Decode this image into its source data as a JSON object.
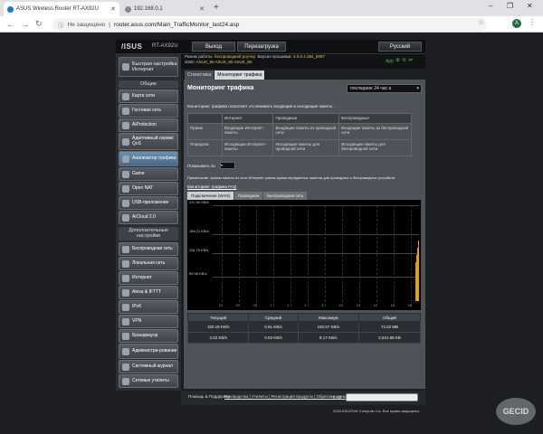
{
  "browser": {
    "tabs": [
      {
        "title": "ASUS Wireless Router RT-AX92U"
      },
      {
        "title": "192.168.0.1"
      }
    ],
    "new_tab": "+",
    "window": {
      "min": "–",
      "max": "❐",
      "close": "✕"
    },
    "address": {
      "security": "Не защищено",
      "url": "router.asus.com/Main_TrafficMonitor_last24.asp"
    },
    "avatar": "A"
  },
  "router": {
    "brand": "/ISUS",
    "model": "RT-AX92U",
    "header_buttons": {
      "logout": "Выход",
      "reboot": "Перезагрузка",
      "language": "Русский"
    },
    "status": {
      "mode_label": "Режим работы:",
      "mode_value": "беспроводной роутер",
      "firmware_label": "Версия прошивки:",
      "firmware_value": "3.0.0.4.384_8097",
      "ssid_label": "SSID:",
      "ssid_values": "ASUS_90  ASUS_90  ASUS_90",
      "app": "App"
    },
    "quick_setup": "Быстрая настройка Интернет",
    "sections": {
      "general": "Общие",
      "advanced": "Дополнительные настройки"
    },
    "nav_general": [
      "Карта сети",
      "Гостевая сеть",
      "AiProtection",
      "Адаптивный сервис QoS",
      "Анализатор трафика",
      "Game",
      "Open NAT",
      "USB-приложение",
      "AiCloud 2.0"
    ],
    "nav_advanced": [
      "Беспроводная сеть",
      "Локальная сеть",
      "Интернет",
      "Alexa & IFTTT",
      "IPv6",
      "VPN",
      "Брандмауэр",
      "Администри-рование",
      "Системный журнал",
      "Сетевые утилиты"
    ],
    "content_tabs": [
      "Статистика",
      "Мониторинг трафика"
    ],
    "page_title": "Мониторинг трафика",
    "period_select": "последние  24  час а",
    "description": "Мониторинг трафика позволяет отслеживать входящие и исходящие пакеты :",
    "legend": {
      "headers": [
        "Интернет",
        "Проводные",
        "Беспроводные"
      ],
      "rows": [
        {
          "label": "Прием",
          "internet": "Входящие Интернет-пакеты",
          "wired": "Входящие пакеты из проводной сети",
          "wireless": "Входящие пакеты из беспроводной сети"
        },
        {
          "label": "Передача",
          "internet": "Исходящие Интернет-пакеты",
          "wired": "Исходящие пакеты для проводной сети",
          "wireless": "Исходящие пакеты для беспроводной сети"
        }
      ]
    },
    "show_by_label": "Показывать по",
    "note": "Примечание: приказ пакеты из сети Интернет равна сумма переданных пакетов для проводных и беспроводных устройств.",
    "faq_link": "Мониторинг трафика FAQ",
    "graph_tabs": [
      "Подключение (WAN)",
      "Проводная",
      "Беспроводная сеть"
    ],
    "chart_data": {
      "type": "line",
      "title": "",
      "xlabel": "",
      "ylabel": "",
      "y_ticks": [
        "237.50 KB/s",
        "166.21 KB/s",
        "118.75 KB/s",
        "59.38 KB/s"
      ],
      "y_values": [
        237.5,
        166.21,
        118.75,
        59.38
      ],
      "x_ticks": [
        "20",
        "22",
        "24",
        "2",
        "4",
        "6",
        "8",
        "10",
        "12",
        "14",
        "16",
        "18"
      ],
      "ylim": [
        0,
        237.5
      ],
      "grid": true,
      "series": [
        {
          "values": [
            0,
            0,
            0,
            0,
            0,
            0,
            0,
            0,
            0,
            0,
            0,
            150.57
          ]
        }
      ]
    },
    "stats": {
      "headers": [
        "Текущий",
        "Средний",
        "Максимум",
        "Общий"
      ],
      "rx": [
        "150.18 KB/s",
        "0.61 KB/s",
        "150.57 KB/s",
        "74.02 MB"
      ],
      "tx": [
        "2.52 KB/s",
        "0.03 KB/s",
        "8.17 KB/s",
        "2,541.88 KB"
      ]
    },
    "footer": {
      "help": "Помощь & Поддержка",
      "links": "Руководство | Утилиты | Регистрация продукта | Обратная связь",
      "faq": "FAQ",
      "copyright": "2020 ASUSTeK Computer Inc. Все права защищены."
    },
    "watermark": "GECID"
  },
  "colors": {
    "rx": "#ff9a3c",
    "tx": "#5ab4ff",
    "chart_line": "#e8a000"
  }
}
